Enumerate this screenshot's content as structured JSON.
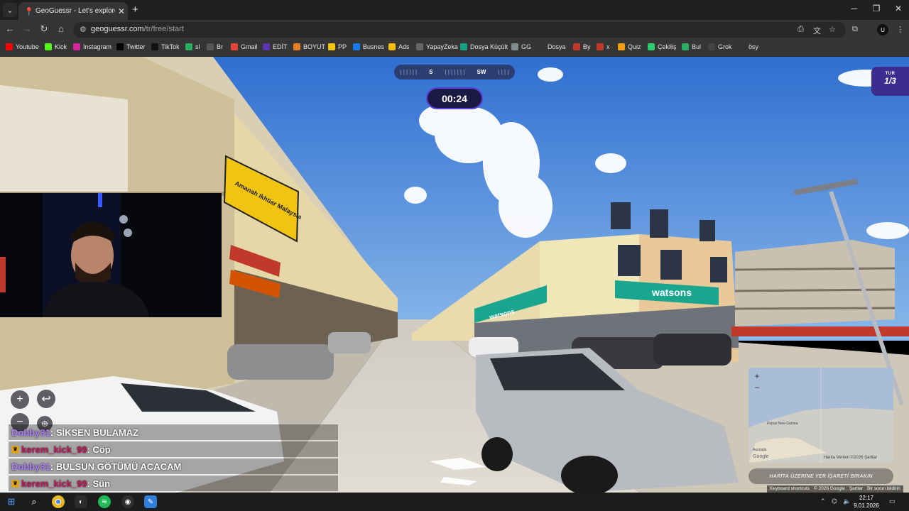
{
  "browser": {
    "tab_title": "GeoGuessr - Let's explore the w",
    "url_host": "geoguessr.com",
    "url_path": "/tr/free/start"
  },
  "bookmarks": [
    {
      "label": "Youtube",
      "icon": "youtube-icon",
      "color": "#ff0000"
    },
    {
      "label": "Kick",
      "icon": "kick-icon",
      "color": "#53fc18"
    },
    {
      "label": "Instagram",
      "icon": "instagram-icon",
      "color": "#d6249f"
    },
    {
      "label": "Twitter",
      "icon": "x-icon",
      "color": "#000000"
    },
    {
      "label": "TikTok",
      "icon": "tiktok-icon",
      "color": "#111111"
    },
    {
      "label": "sl",
      "icon": "sl-icon",
      "color": "#27ae60"
    },
    {
      "label": "Br",
      "icon": "br-icon",
      "color": "#555555"
    },
    {
      "label": "Gmail",
      "icon": "gmail-icon",
      "color": "#ea4335"
    },
    {
      "label": "EDİT",
      "icon": "edit-icon",
      "color": "#5e35b1"
    },
    {
      "label": "BOYUT",
      "icon": "boyut-icon",
      "color": "#e67e22"
    },
    {
      "label": "PP",
      "icon": "pp-icon",
      "color": "#f1c40f"
    },
    {
      "label": "Busnes",
      "icon": "meta-icon",
      "color": "#1877f2"
    },
    {
      "label": "Ads",
      "icon": "google-ads-icon",
      "color": "#fbbc04"
    },
    {
      "label": "YapayZeka",
      "icon": "openai-icon",
      "color": "#666666"
    },
    {
      "label": "Dosya Küçült",
      "icon": "rp-icon",
      "color": "#16a085"
    },
    {
      "label": "GG",
      "icon": "gg-icon",
      "color": "#7f8c8d"
    },
    {
      "label": "Dosya",
      "icon": "folder-icon",
      "color": "#353535"
    },
    {
      "label": "By",
      "icon": "by-icon",
      "color": "#c0392b"
    },
    {
      "label": "x",
      "icon": "x-bookmark-icon",
      "color": "#c0392b"
    },
    {
      "label": "Quiz",
      "icon": "quiz-icon",
      "color": "#f39c12"
    },
    {
      "label": "Çekiliş",
      "icon": "cekilis-icon",
      "color": "#2ecc71"
    },
    {
      "label": "Bul",
      "icon": "bul-icon",
      "color": "#27ae60"
    },
    {
      "label": "Grok",
      "icon": "grok-icon",
      "color": "#444444"
    },
    {
      "label": "ösy",
      "icon": "folder-icon",
      "color": "#353535"
    }
  ],
  "game": {
    "compass": [
      "S",
      "SW"
    ],
    "timer": "00:24",
    "round_label": "TUR",
    "round_value": "1/3",
    "guess_button": "HARİTA ÜZERİNE YER İŞARETİ BIRAKIN",
    "map_attribution": "Harita Verileri ©2026  Şartlar",
    "minimap_labels": [
      "Papua New Guinea",
      "Australia"
    ]
  },
  "footer": {
    "shortcuts": "Keyboard shortcuts",
    "copyright": "© 2026 Google",
    "terms": "Şartlar",
    "report": "Bir sorun bildirin"
  },
  "scene_text": {
    "watsons": "watsons",
    "amanah": "Amanah Ikhtiar Malaysia",
    "google": "Google"
  },
  "chat": [
    {
      "user": "Dobby31",
      "message": " : SİKSEN BULAMAZ",
      "user_color": "#b07cff",
      "badge": false
    },
    {
      "user": "kerem_kick_99",
      "message": " : Cöp",
      "user_color": "#c2185b",
      "badge": true
    },
    {
      "user": "Dobby31",
      "message": " : BULSUN GÖTÜMÜ ACACAM",
      "user_color": "#b07cff",
      "badge": false
    },
    {
      "user": "kerem_kick_99",
      "message": " : Sün",
      "user_color": "#c2185b",
      "badge": true
    }
  ],
  "taskbar": {
    "time": "22:17",
    "date": "9.01.2026",
    "apps": [
      "windows-icon",
      "search-icon",
      "chrome-icon",
      "app-icon",
      "spotify-icon",
      "obs-icon",
      "paint-icon"
    ]
  }
}
